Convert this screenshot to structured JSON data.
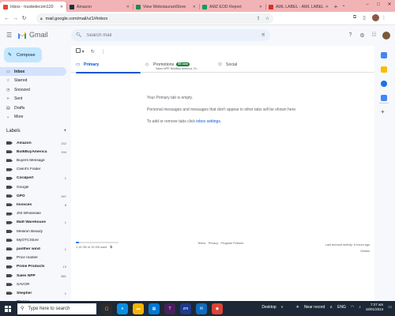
{
  "browser": {
    "tabs": [
      {
        "title": "Inbox - trustedecom120",
        "favicon_color": "#ea4335"
      },
      {
        "title": "Amazon",
        "favicon_color": "#232f3e"
      },
      {
        "title": "View WebstaurantStore",
        "favicon_color": "#1f8b4c"
      },
      {
        "title": "AMZ EOD Report",
        "favicon_color": "#0f9d58"
      },
      {
        "title": "AWL LABEL - AWL LABEL",
        "favicon_color": "#d93025"
      }
    ],
    "url": "mail.google.com/mail/u/1/#inbox"
  },
  "gmail": {
    "logo_text": "Gmail",
    "search_placeholder": "Search mail",
    "compose_label": "Compose",
    "nav": [
      {
        "label": "Inbox",
        "icon": "inbox-icon",
        "active": true
      },
      {
        "label": "Starred",
        "icon": "star-icon"
      },
      {
        "label": "Snoozed",
        "icon": "clock-icon"
      },
      {
        "label": "Sent",
        "icon": "send-icon"
      },
      {
        "label": "Drafts",
        "icon": "draft-icon"
      },
      {
        "label": "More",
        "icon": "chevron-down-icon"
      }
    ],
    "labels_heading": "Labels",
    "labels": [
      {
        "name": "Amazon",
        "count": "242",
        "bold": true
      },
      {
        "name": "BulkBuyAmerica",
        "count": "194",
        "bold": true
      },
      {
        "name": "Buyers Message",
        "count": "",
        "bold": false
      },
      {
        "name": "Client's Folder",
        "count": "",
        "bold": false
      },
      {
        "name": "Coralpert",
        "count": "1",
        "bold": true
      },
      {
        "name": "Google",
        "count": "",
        "bold": false
      },
      {
        "name": "GPO",
        "count": "947",
        "bold": true
      },
      {
        "name": "Invoices",
        "count": "8",
        "bold": true
      },
      {
        "name": "JNI Wholesale",
        "count": "",
        "bold": false
      },
      {
        "name": "Matt Warehouse",
        "count": "1",
        "bold": true
      },
      {
        "name": "Melanin Beauty",
        "count": "",
        "bold": false
      },
      {
        "name": "MyOTCStore",
        "count": "",
        "bold": false
      },
      {
        "name": "panther wind",
        "count": "1",
        "bold": true
      },
      {
        "name": "Price master",
        "count": "",
        "bold": false
      },
      {
        "name": "Prime Products",
        "count": "13",
        "bold": true
      },
      {
        "name": "Sales NPP",
        "count": "881",
        "bold": true
      },
      {
        "name": "SAVOR",
        "count": "",
        "bold": false
      },
      {
        "name": "Shepher",
        "count": "1",
        "bold": true
      },
      {
        "name": "Shippo",
        "count": "3",
        "bold": true
      }
    ],
    "tabs": [
      {
        "label": "Primary",
        "icon": "inbox-icon",
        "active": true
      },
      {
        "label": "Promotions",
        "icon": "tag-icon",
        "badge": "50 new",
        "sub": "Sales NPP, BulkBuy America, Di..."
      },
      {
        "label": "Social",
        "icon": "people-icon"
      }
    ],
    "empty": {
      "title": "Your Primary tab is empty.",
      "desc": "Personal messages and messages that don't appear in other tabs will be shown here.",
      "hint_prefix": "To add or remove tabs click",
      "hint_link": "inbox settings"
    },
    "footer": {
      "storage": "1.15 GB of 15 GB used",
      "storage_fraction": 0.077,
      "terms": "Terms · Privacy · Program Policies",
      "activity": "Last account activity: 6 hours ago",
      "details": "Details"
    }
  },
  "taskbar": {
    "search_placeholder": "Type here to search",
    "desktop": "Desktop",
    "weather": "Near record",
    "lang": "ENG",
    "time": "7:27 am",
    "date": "18/01/2024"
  }
}
